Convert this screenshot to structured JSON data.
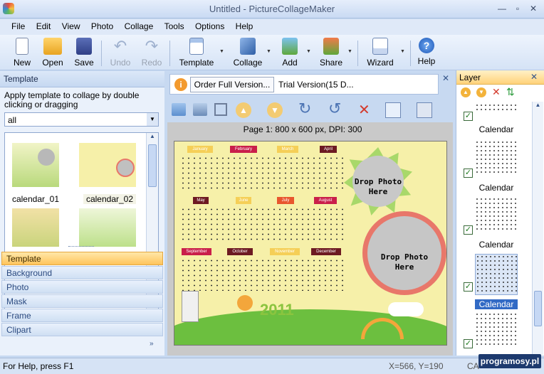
{
  "window": {
    "title": "Untitled - PictureCollageMaker"
  },
  "menu": [
    "File",
    "Edit",
    "View",
    "Photo",
    "Collage",
    "Tools",
    "Options",
    "Help"
  ],
  "toolbar": {
    "new": "New",
    "open": "Open",
    "save": "Save",
    "undo": "Undo",
    "redo": "Redo",
    "template": "Template",
    "collage": "Collage",
    "add": "Add",
    "share": "Share",
    "wizard": "Wizard",
    "help": "Help"
  },
  "left": {
    "header": "Template",
    "instruction": "Apply template to collage by double clicking or dragging",
    "filter": "all",
    "thumbs": [
      {
        "label": "calendar_01"
      },
      {
        "label": "calendar_02"
      }
    ],
    "accordion": [
      "Template",
      "Background",
      "Photo",
      "Mask",
      "Frame",
      "Clipart"
    ]
  },
  "info": {
    "order_button": "Order Full Version...",
    "trial": "Trial Version(15 D..."
  },
  "canvas": {
    "page_info": "Page 1: 800 x 600 px, DPI: 300"
  },
  "collage": {
    "months_row1": [
      "January",
      "February",
      "March",
      "April"
    ],
    "months_row2": [
      "May",
      "June",
      "July",
      "August"
    ],
    "months_row3": [
      "September",
      "October",
      "November",
      "December"
    ],
    "drop1": "Drop Photo Here",
    "drop2": "Drop Photo Here",
    "year": "2011"
  },
  "layer": {
    "header": "Layer",
    "items": [
      {
        "label": "Calendar",
        "selected": false
      },
      {
        "label": "Calendar",
        "selected": false
      },
      {
        "label": "Calendar",
        "selected": false
      },
      {
        "label": "Calendar",
        "selected": true
      }
    ]
  },
  "status": {
    "help": "For Help, press F1",
    "coords": "X=566, Y=190",
    "caps": "CA",
    "watermark": "programosy.pl"
  },
  "colors": {
    "accent": "#ffc45c",
    "panel": "#c7d9f1",
    "collage_bg": "#f6f0a9",
    "drop_ring": "#e8776a",
    "star": "#a8d86a"
  }
}
